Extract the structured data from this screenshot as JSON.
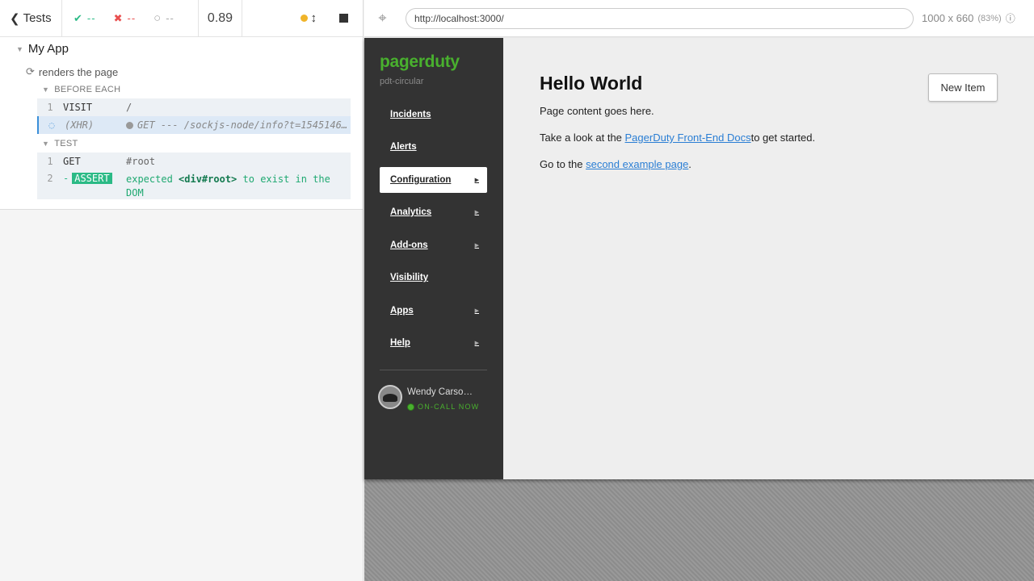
{
  "reporter": {
    "header": {
      "back_label": "Tests",
      "passed": "--",
      "failed": "--",
      "pending": "--",
      "duration": "0.89"
    },
    "suite": {
      "title": "My App",
      "test_title": "renders the page",
      "before_each_label": "BEFORE EACH",
      "test_label": "TEST",
      "before_each_commands": [
        {
          "num": "1",
          "name": "VISIT",
          "message": "/"
        },
        {
          "num": "",
          "name": "(XHR)",
          "message": "GET --- /sockjs-node/info?t=1545146…"
        }
      ],
      "test_commands": [
        {
          "num": "1",
          "name": "GET",
          "message": "#root"
        },
        {
          "num": "2",
          "name": "ASSERT",
          "prefix": "-",
          "msg_start": "expected",
          "msg_subject": "<div#root>",
          "msg_end": "to exist in the",
          "msg_tail": "DOM"
        }
      ]
    }
  },
  "aut_header": {
    "url": "http://localhost:3000/",
    "viewport": "1000 x 660",
    "scale": "(83%)"
  },
  "app": {
    "brand": "pagerduty",
    "brand_sub": "pdt-circular",
    "nav": [
      {
        "label": "Incidents",
        "arrow": false
      },
      {
        "label": "Alerts",
        "arrow": false
      },
      {
        "label": "Configuration",
        "arrow": true,
        "active": true
      },
      {
        "label": "Analytics",
        "arrow": true
      },
      {
        "label": "Add-ons",
        "arrow": true
      },
      {
        "label": "Visibility",
        "arrow": false
      },
      {
        "label": "Apps",
        "arrow": true
      },
      {
        "label": "Help",
        "arrow": true
      }
    ],
    "user_name": "Wendy Carso…",
    "user_status": "ON-CALL NOW",
    "page_title": "Hello World",
    "p1": "Page content goes here.",
    "p2_before": "Take a look at the ",
    "p2_link": "PagerDuty Front-End Docs",
    "p2_after": "to get started.",
    "p3_before": "Go to the ",
    "p3_link": "second example page",
    "p3_after": ".",
    "new_item_label": "New Item"
  },
  "colors": {
    "pass": "#2bba86",
    "fail": "#e94f4f",
    "brand": "#49b02e",
    "link": "#2a7ed4"
  }
}
